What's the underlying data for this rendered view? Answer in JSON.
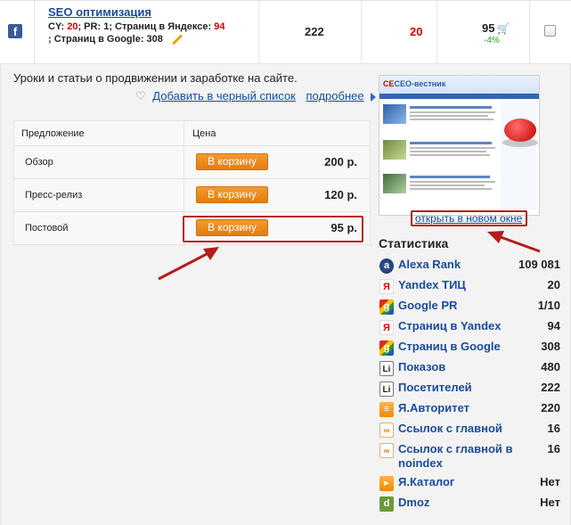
{
  "site": {
    "title": "SEO оптимизация",
    "cy_label": "CY:",
    "cy_value": "20",
    "pr_label": "; PR:",
    "pr_value": "1",
    "yandex_pages_label": "; Страниц в Яндексе:",
    "yandex_pages_value": "94",
    "google_pages_label": "; Страниц в Google:",
    "google_pages_value": "308",
    "col_visitors": "222",
    "col_cy": "20",
    "price": "95",
    "discount": "-4%"
  },
  "description": "Уроки и статьи о продвижении и заработке на сайте.",
  "actions": {
    "blacklist_link": "Добавить в черный список",
    "more_link": "подробнее"
  },
  "offers": {
    "header_offer": "Предложение",
    "header_price": "Цена",
    "rows": [
      {
        "name": "Обзор",
        "button": "В корзину",
        "price": "200 р."
      },
      {
        "name": "Пресс-релиз",
        "button": "В корзину",
        "price": "120 р."
      },
      {
        "name": "Постовой",
        "button": "В корзину",
        "price": "95 р."
      }
    ]
  },
  "preview": {
    "logo": "СЕО-вестник",
    "open_link": "открыть в новом окне"
  },
  "stats": {
    "title": "Статистика",
    "items": [
      {
        "label": "Alexa Rank",
        "value": "109 081",
        "icon": "alexa-icon"
      },
      {
        "label": "Yandex ТИЦ",
        "value": "20",
        "icon": "yandex-icon"
      },
      {
        "label": "Google PR",
        "value": "1/10",
        "icon": "google-icon"
      },
      {
        "label": "Страниц в Yandex",
        "value": "94",
        "icon": "yandex-icon"
      },
      {
        "label": "Страниц в Google",
        "value": "308",
        "icon": "google-icon"
      },
      {
        "label": "Показов",
        "value": "480",
        "icon": "liveinternet-icon"
      },
      {
        "label": "Посетителей",
        "value": "222",
        "icon": "liveinternet-icon"
      },
      {
        "label": "Я.Авторитет",
        "value": "220",
        "icon": "ya-authority-icon"
      },
      {
        "label": "Ссылок с главной",
        "value": "16",
        "icon": "link-icon"
      },
      {
        "label": "Ссылок с главной в noindex",
        "value": "16",
        "icon": "link-icon"
      },
      {
        "label": "Я.Каталог",
        "value": "Нет",
        "icon": "ya-catalog-icon"
      },
      {
        "label": "Dmoz",
        "value": "Нет",
        "icon": "dmoz-icon"
      }
    ]
  },
  "colors": {
    "link": "#1a4b9a",
    "accent_red": "#d40000",
    "button_orange": "#e57c0a",
    "annotation_red": "#b51c1c"
  }
}
